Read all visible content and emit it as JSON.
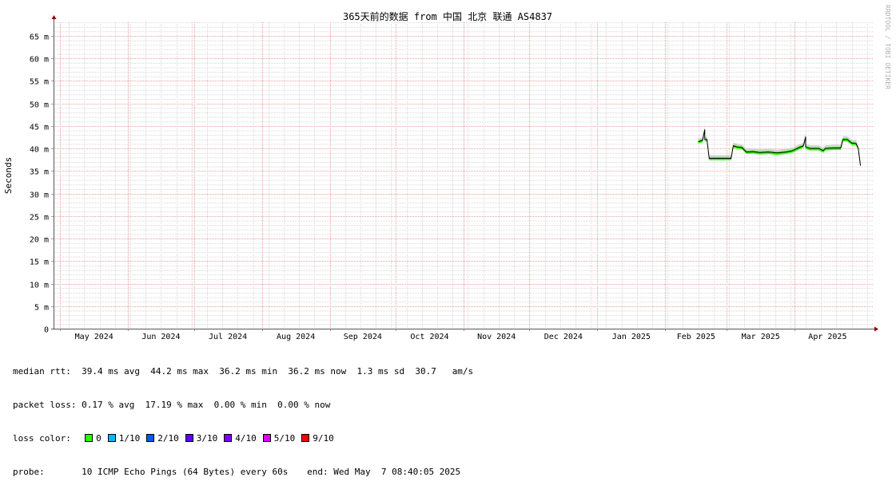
{
  "chart_data": {
    "type": "line",
    "title": "365天前的数据 from 中国 北京 联通 AS4837",
    "xlabel": "",
    "ylabel": "Seconds",
    "watermark": "RRDTOOL / TOBI OETIKER",
    "ylim": [
      0,
      68
    ],
    "y_ticks": [
      0,
      5,
      10,
      15,
      20,
      25,
      30,
      35,
      40,
      45,
      50,
      55,
      60,
      65
    ],
    "y_tick_labels": [
      "0",
      "5 m",
      "10 m",
      "15 m",
      "20 m",
      "25 m",
      "30 m",
      "35 m",
      "40 m",
      "45 m",
      "50 m",
      "55 m",
      "60 m",
      "65 m"
    ],
    "x_range": [
      "2024-04-28",
      "2025-05-07"
    ],
    "x_ticks": [
      "2024-05-01",
      "2024-06-01",
      "2024-07-01",
      "2024-08-01",
      "2024-09-01",
      "2024-10-01",
      "2024-11-01",
      "2024-12-01",
      "2025-01-01",
      "2025-02-01",
      "2025-03-01",
      "2025-04-01"
    ],
    "x_tick_labels": [
      "May 2024",
      "Jun 2024",
      "Jul 2024",
      "Aug 2024",
      "Sep 2024",
      "Oct 2024",
      "Nov 2024",
      "Dec 2024",
      "Jan 2025",
      "Feb 2025",
      "Mar 2025",
      "Apr 2025"
    ],
    "grid": true,
    "series": [
      {
        "name": "median rtt",
        "color": "#000000",
        "points": [
          [
            "2025-02-16",
            41.5
          ],
          [
            "2025-02-18",
            41.8
          ],
          [
            "2025-02-19",
            44.2
          ],
          [
            "2025-02-19",
            42.0
          ],
          [
            "2025-02-20",
            42.0
          ],
          [
            "2025-02-21",
            37.8
          ],
          [
            "2025-02-25",
            37.8
          ],
          [
            "2025-03-01",
            37.8
          ],
          [
            "2025-03-03",
            37.8
          ],
          [
            "2025-03-04",
            40.6
          ],
          [
            "2025-03-06",
            40.3
          ],
          [
            "2025-03-08",
            40.2
          ],
          [
            "2025-03-10",
            39.2
          ],
          [
            "2025-03-13",
            39.3
          ],
          [
            "2025-03-16",
            39.1
          ],
          [
            "2025-03-20",
            39.2
          ],
          [
            "2025-03-24",
            39.0
          ],
          [
            "2025-03-28",
            39.2
          ],
          [
            "2025-03-31",
            39.5
          ],
          [
            "2025-04-03",
            40.2
          ],
          [
            "2025-04-05",
            40.6
          ],
          [
            "2025-04-06",
            42.6
          ],
          [
            "2025-04-06",
            40.3
          ],
          [
            "2025-04-08",
            40.0
          ],
          [
            "2025-04-12",
            40.0
          ],
          [
            "2025-04-14",
            39.5
          ],
          [
            "2025-04-15",
            40.0
          ],
          [
            "2025-04-19",
            40.1
          ],
          [
            "2025-04-22",
            40.1
          ],
          [
            "2025-04-23",
            42.0
          ],
          [
            "2025-04-25",
            42.0
          ],
          [
            "2025-04-27",
            41.2
          ],
          [
            "2025-04-29",
            41.1
          ],
          [
            "2025-04-30",
            40.0
          ],
          [
            "2025-05-01",
            36.2
          ]
        ]
      }
    ],
    "loss_colors": [
      {
        "label": "0",
        "color": "#26ff00"
      },
      {
        "label": "1/10",
        "color": "#00b8ff"
      },
      {
        "label": "2/10",
        "color": "#0059ff"
      },
      {
        "label": "3/10",
        "color": "#5e00ff"
      },
      {
        "label": "4/10",
        "color": "#7e00ff"
      },
      {
        "label": "5/10",
        "color": "#dd00ff"
      },
      {
        "label": "9/10",
        "color": "#ff0000"
      }
    ]
  },
  "stats": {
    "median_rtt_label": "median rtt:",
    "median_rtt_values": "39.4 ms avg  44.2 ms max  36.2 ms min  36.2 ms now  1.3 ms sd  30.7   am/s",
    "packet_loss_label": "packet loss:",
    "packet_loss_values": "0.17 % avg  17.19 % max  0.00 % min  0.00 % now",
    "loss_color_label": "loss color:",
    "probe_label": "probe:",
    "probe_value": "10 ICMP Echo Pings (64 Bytes) every 60s",
    "end_label": "end: Wed May  7 08:40:05 2025"
  }
}
